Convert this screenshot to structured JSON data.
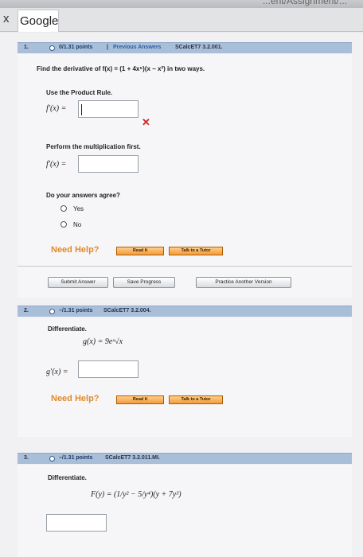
{
  "browser": {
    "url_fragment": "...ent/Assignment/...",
    "tab_close": "x",
    "tab_title": "Google"
  },
  "q1": {
    "number": "1.",
    "points": "0/1.31 points",
    "separator": "|",
    "previous": "Previous Answers",
    "code": "SCalcET7 3.2.001.",
    "prompt": "Find the derivative of f(x) = (1 + 4x⁵)(x − x²) in two ways.",
    "part1_label": "Use the Product Rule.",
    "part1_answer_label": "f′(x) =",
    "part1_value": "",
    "wrong_mark": "✕",
    "part2_label": "Perform the multiplication first.",
    "part2_answer_label": "f′(x) =",
    "part2_value": "",
    "agree_label": "Do your answers agree?",
    "opt_yes": "Yes",
    "opt_no": "No",
    "help_label": "Need Help?",
    "read_it": "Read It",
    "talk_to_tutor": "Talk to a Tutor",
    "submit": "Submit Answer",
    "save": "Save Progress",
    "practice": "Practice Another Version"
  },
  "q2": {
    "number": "2.",
    "points": "–/1.31 points",
    "code": "SCalcET7 3.2.004.",
    "instruction": "Differentiate.",
    "function": "g(x) = 9eˣ√x",
    "answer_label": "g′(x) =",
    "value": "",
    "help_label": "Need Help?",
    "read_it": "Read It",
    "talk_to_tutor": "Talk to a Tutor"
  },
  "q3": {
    "number": "3.",
    "points": "–/1.31 points",
    "code": "SCalcET7 3.2.011.MI.",
    "instruction": "Differentiate.",
    "function": "F(y) = (1/y² − 5/y⁴)(y + 7y³)",
    "value": ""
  }
}
